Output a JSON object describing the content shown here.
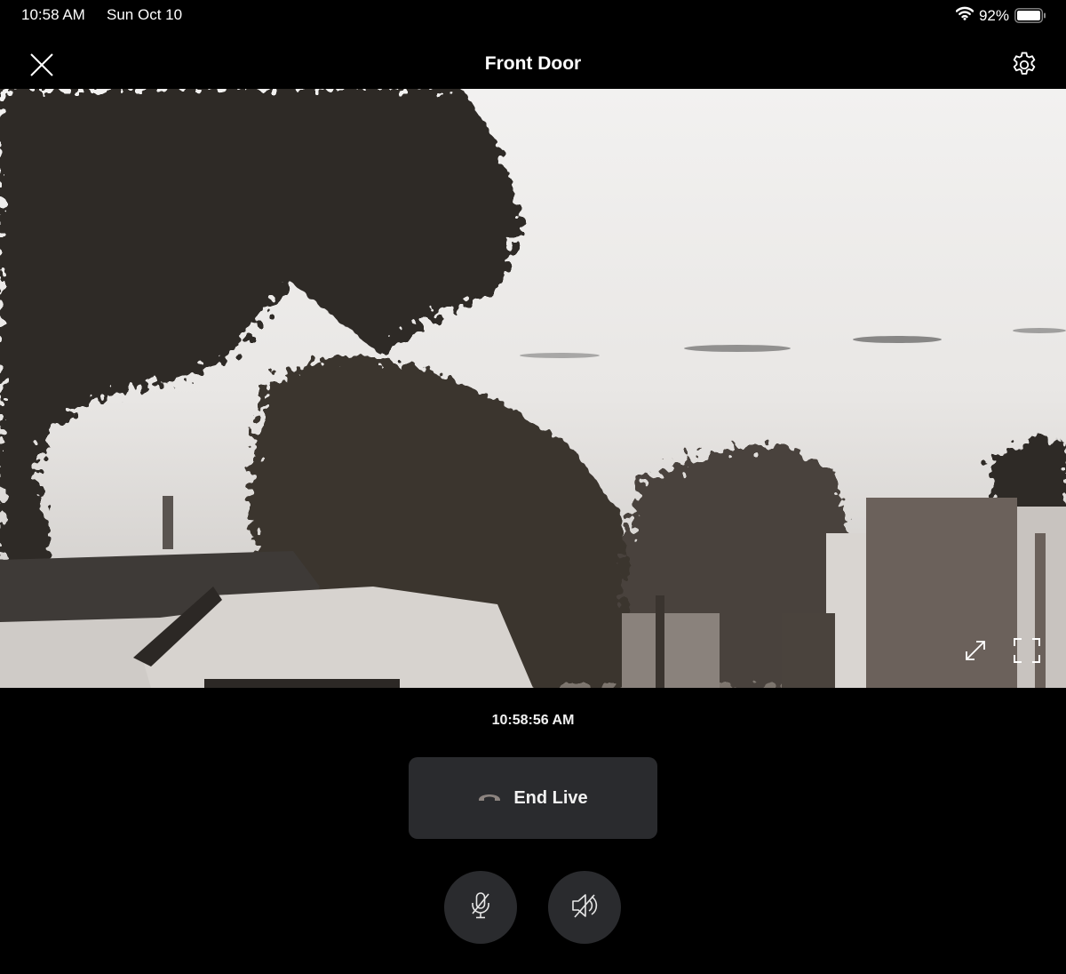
{
  "status_bar": {
    "time": "10:58 AM",
    "date": "Sun Oct 10",
    "battery_percent": "92%",
    "icons": [
      "wifi-icon",
      "battery-icon"
    ]
  },
  "nav": {
    "title": "Front Door",
    "close_icon": "close-icon",
    "settings_icon": "gear-icon"
  },
  "video": {
    "description": "Live camera feed showing trees and rooftops",
    "controls": [
      "expand-icon",
      "fullscreen-icon"
    ]
  },
  "timestamp": "10:58:56 AM",
  "end_live": {
    "label": "End Live",
    "icon": "phone-hangup-icon"
  },
  "audio_controls": {
    "mic": "microphone-muted-icon",
    "speaker": "speaker-muted-icon"
  },
  "colors": {
    "background": "#000000",
    "button_bg": "#2a2b2e",
    "text": "#f2f2f2",
    "hangup_icon": "#8c8480"
  }
}
